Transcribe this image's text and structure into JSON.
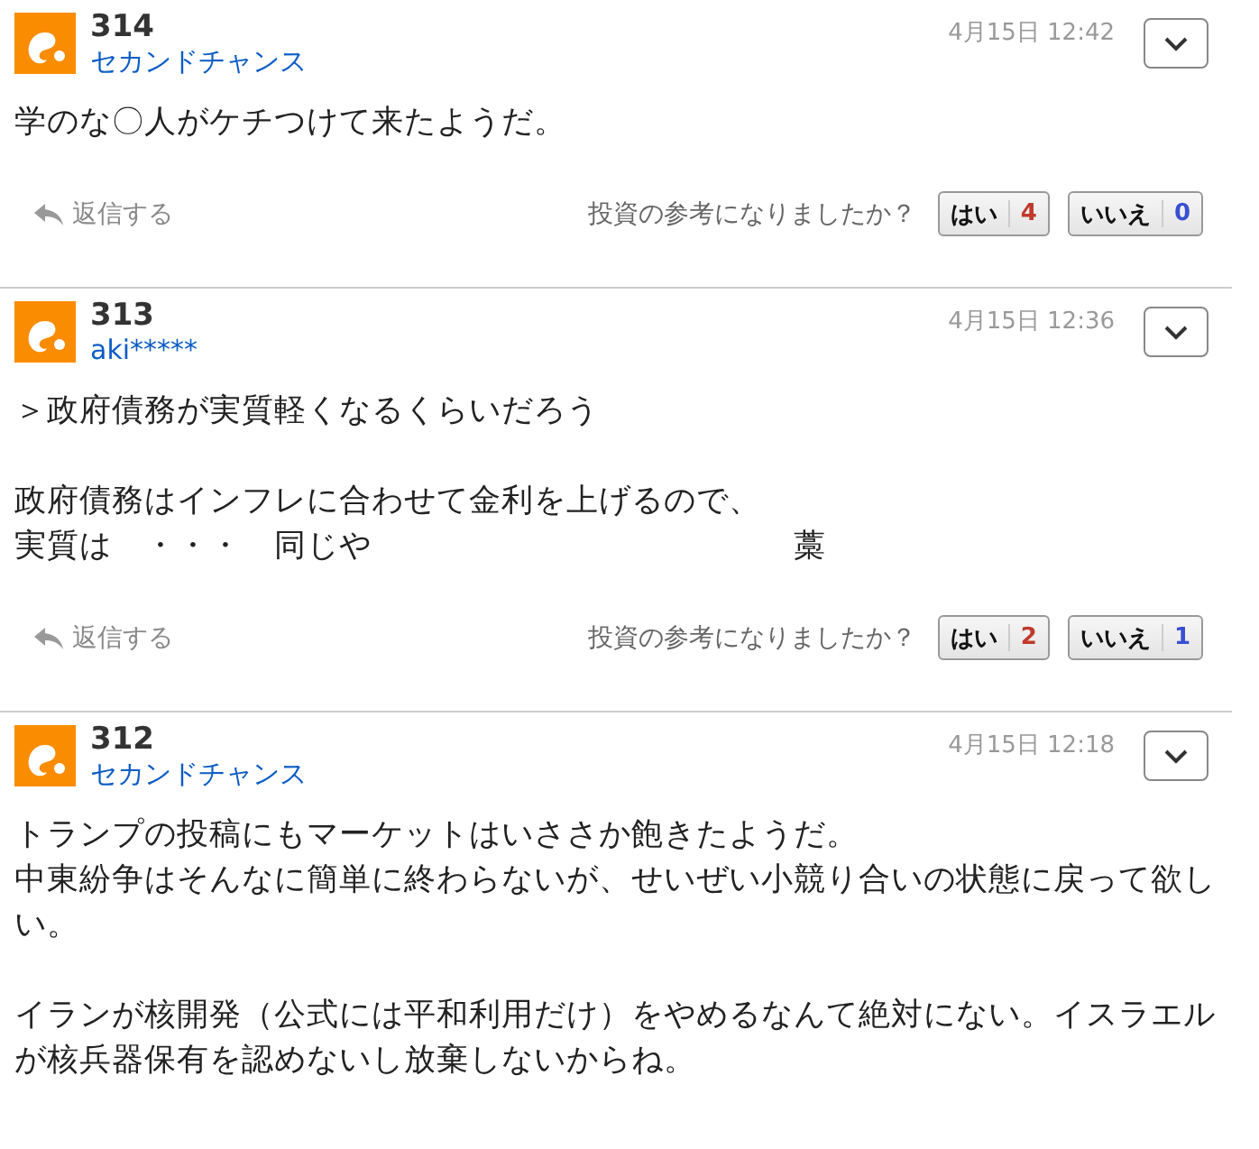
{
  "posts": [
    {
      "number": "314",
      "author": "セカンドチャンス",
      "date": "4月15日 12:42",
      "paragraphs": [
        [
          "学のな〇人がケチつけて来たようだ。"
        ]
      ],
      "footer": {
        "reply": "返信する",
        "question": "投資の参考になりましたか？",
        "yes": {
          "label": "はい",
          "count": "4"
        },
        "no": {
          "label": "いいえ",
          "count": "0"
        }
      }
    },
    {
      "number": "313",
      "author": "aki*****",
      "date": "4月15日 12:36",
      "paragraphs": [
        [
          "＞政府債務が実質軽くなるくらいだろう"
        ],
        [
          "政府債務はインフレに合わせて金利を上げるので、",
          "実質は　・・・　同じや　　　　　　　　　　　　　藁"
        ]
      ],
      "footer": {
        "reply": "返信する",
        "question": "投資の参考になりましたか？",
        "yes": {
          "label": "はい",
          "count": "2"
        },
        "no": {
          "label": "いいえ",
          "count": "1"
        }
      }
    },
    {
      "number": "312",
      "author": "セカンドチャンス",
      "date": "4月15日 12:18",
      "paragraphs": [
        [
          "トランプの投稿にもマーケットはいささか飽きたようだ。",
          "中東紛争はそんなに簡単に終わらないが、せいぜい小競り合いの状態に戻って欲しい。"
        ],
        [
          "イランが核開発（公式には平和利用だけ）をやめるなんて絶対にない。イスラエルが核兵器保有を認めないし放棄しないからね。"
        ]
      ]
    }
  ]
}
